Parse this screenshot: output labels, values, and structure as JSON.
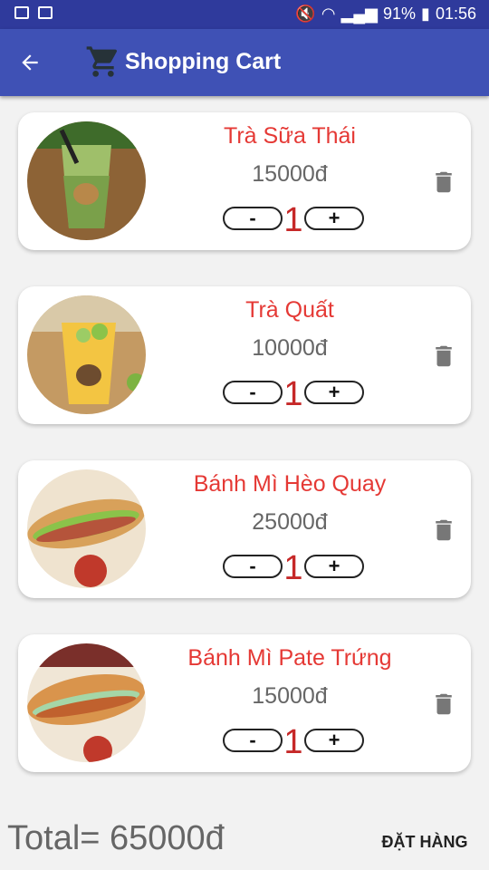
{
  "statusbar": {
    "battery": "91%",
    "time": "01:56"
  },
  "appbar": {
    "title": "Shopping Cart"
  },
  "items": [
    {
      "name": "Trà Sữa Thái",
      "price": "15000đ",
      "quantity": "1"
    },
    {
      "name": "Trà Quất",
      "price": "10000đ",
      "quantity": "1"
    },
    {
      "name": "Bánh Mì Hèo Quay",
      "price": "25000đ",
      "quantity": "1"
    },
    {
      "name": "Bánh Mì Pate Trứng",
      "price": "15000đ",
      "quantity": "1"
    }
  ],
  "controls": {
    "minus": "-",
    "plus": "+"
  },
  "footer": {
    "total": "Total= 65000đ",
    "order_button": "ĐẶT HÀNG"
  },
  "colors": {
    "appbar": "#3f51b5",
    "statusbar": "#2f3a9c",
    "name_red": "#e53935",
    "qty_red": "#c62828"
  }
}
